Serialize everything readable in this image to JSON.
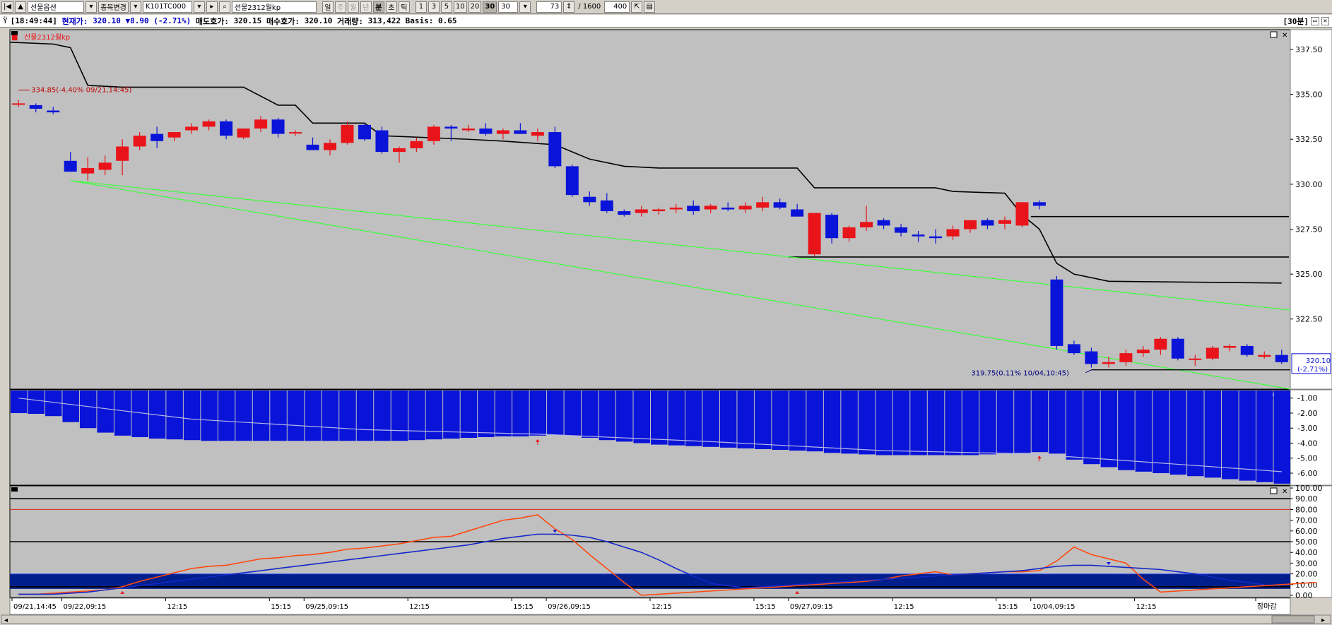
{
  "toolbar": {
    "nav_first": "|◀",
    "nav_up": "▲",
    "market_dropdown": "선물옵션",
    "change_button": "종목변경",
    "code_field": "K101TC000",
    "name_field": "선물2312월kp",
    "periods": [
      "일",
      "주",
      "월",
      "년",
      "분",
      "초",
      "틱"
    ],
    "period_selected": "분",
    "intervals": [
      "1",
      "3",
      "5",
      "10",
      "20",
      "30"
    ],
    "interval_selected": "30",
    "interval_input": "30",
    "count_field": "73",
    "total_label": "/ 1600",
    "display_field": "400"
  },
  "infobar": {
    "time": "[18:49:44]",
    "current_label": "현재가:",
    "current_value": "320.10",
    "change": "▼8.90",
    "change_pct": "(-2.71%)",
    "ask_label": "매도호가:",
    "ask_value": "320.15",
    "bid_label": "매수호가:",
    "bid_value": "320.10",
    "volume_label": "거래량:",
    "volume_value": "313,422",
    "basis_label": "Basis:",
    "basis_value": "0.65",
    "period_badge": "[30분]"
  },
  "colors": {
    "up": "#e8141a",
    "down": "#0a14d8",
    "plot_bg": "#c0c0c0",
    "trend": "#3cff3c",
    "stoch_k": "#ff4a10",
    "stoch_d": "#1428c8",
    "band": "#001e8c"
  },
  "chart_data": [
    {
      "type": "candlestick",
      "title": "선물2312월kp",
      "ylim": [
        318.6,
        338.6
      ],
      "y_ticks": [
        "337.50",
        "335.00",
        "332.50",
        "330.00",
        "327.50",
        "325.00",
        "322.50"
      ],
      "current_price_label": "320.10",
      "current_change_label": "(-2.71%)",
      "high_annotation": "334.85(-4.40% 09/21,14:45)",
      "low_annotation": "319.75(0.11% 10/04,10:45)",
      "candles": [
        [
          334.5,
          334.7,
          334.3,
          334.5
        ],
        [
          334.4,
          334.5,
          334.0,
          334.2
        ],
        [
          334.1,
          334.3,
          333.9,
          334.0
        ],
        [
          331.3,
          331.8,
          330.7,
          330.7
        ],
        [
          330.6,
          331.5,
          330.2,
          330.9
        ],
        [
          330.8,
          331.6,
          330.5,
          331.2
        ],
        [
          331.3,
          332.5,
          330.5,
          332.1
        ],
        [
          332.1,
          332.9,
          331.9,
          332.7
        ],
        [
          332.8,
          333.2,
          332.0,
          332.4
        ],
        [
          332.6,
          332.9,
          332.4,
          332.9
        ],
        [
          333.0,
          333.4,
          332.8,
          333.2
        ],
        [
          333.2,
          333.6,
          333.0,
          333.5
        ],
        [
          333.5,
          333.6,
          332.5,
          332.7
        ],
        [
          332.6,
          333.1,
          332.5,
          333.1
        ],
        [
          333.1,
          333.8,
          332.9,
          333.6
        ],
        [
          333.6,
          333.7,
          332.6,
          332.8
        ],
        [
          332.9,
          333.0,
          332.7,
          332.9
        ],
        [
          332.2,
          332.6,
          331.9,
          331.9
        ],
        [
          331.9,
          332.5,
          331.6,
          332.3
        ],
        [
          332.3,
          333.5,
          332.2,
          333.3
        ],
        [
          333.3,
          333.4,
          332.4,
          332.5
        ],
        [
          333.0,
          333.2,
          331.7,
          331.8
        ],
        [
          331.8,
          332.1,
          331.2,
          332.0
        ],
        [
          332.0,
          332.6,
          331.8,
          332.4
        ],
        [
          332.4,
          333.3,
          332.2,
          333.2
        ],
        [
          333.2,
          333.3,
          332.4,
          333.1
        ],
        [
          333.0,
          333.3,
          332.9,
          333.1
        ],
        [
          333.1,
          333.4,
          332.7,
          332.8
        ],
        [
          332.8,
          333.1,
          332.5,
          333.0
        ],
        [
          333.0,
          333.4,
          332.8,
          332.8
        ],
        [
          332.7,
          333.1,
          332.4,
          332.9
        ],
        [
          332.9,
          333.2,
          330.9,
          331.0
        ],
        [
          331.0,
          331.1,
          329.3,
          329.4
        ],
        [
          329.3,
          329.6,
          328.8,
          329.0
        ],
        [
          329.1,
          329.5,
          328.4,
          328.5
        ],
        [
          328.5,
          328.6,
          328.2,
          328.3
        ],
        [
          328.4,
          328.8,
          328.2,
          328.6
        ],
        [
          328.5,
          328.7,
          328.3,
          328.6
        ],
        [
          328.6,
          328.9,
          328.4,
          328.7
        ],
        [
          328.8,
          329.1,
          328.3,
          328.5
        ],
        [
          328.6,
          328.9,
          328.4,
          328.8
        ],
        [
          328.7,
          329.0,
          328.5,
          328.6
        ],
        [
          328.6,
          329.0,
          328.4,
          328.8
        ],
        [
          328.7,
          329.3,
          328.5,
          329.0
        ],
        [
          329.0,
          329.2,
          328.6,
          328.7
        ],
        [
          328.6,
          328.9,
          328.2,
          328.2
        ],
        [
          326.1,
          328.4,
          326.0,
          328.4
        ],
        [
          328.3,
          328.4,
          326.7,
          327.0
        ],
        [
          327.0,
          327.7,
          326.8,
          327.6
        ],
        [
          327.6,
          328.8,
          327.4,
          327.9
        ],
        [
          328.0,
          328.1,
          327.5,
          327.7
        ],
        [
          327.6,
          327.8,
          327.1,
          327.3
        ],
        [
          327.2,
          327.4,
          326.8,
          327.1
        ],
        [
          327.1,
          327.5,
          326.7,
          327.0
        ],
        [
          327.1,
          327.7,
          326.9,
          327.5
        ],
        [
          327.5,
          328.0,
          327.3,
          328.0
        ],
        [
          328.0,
          328.1,
          327.5,
          327.7
        ],
        [
          327.8,
          328.2,
          327.5,
          328.0
        ],
        [
          327.7,
          329.0,
          327.6,
          329.0
        ],
        [
          329.0,
          329.1,
          328.6,
          328.8
        ],
        [
          324.7,
          324.9,
          320.8,
          321.0
        ],
        [
          321.1,
          321.3,
          320.5,
          320.6
        ],
        [
          320.7,
          320.9,
          319.8,
          320.0
        ],
        [
          320.0,
          320.4,
          319.8,
          320.1
        ],
        [
          320.1,
          320.8,
          319.9,
          320.6
        ],
        [
          320.6,
          321.0,
          320.4,
          320.8
        ],
        [
          320.8,
          321.5,
          320.5,
          321.4
        ],
        [
          321.4,
          321.5,
          320.2,
          320.3
        ],
        [
          320.3,
          320.5,
          319.9,
          320.3
        ],
        [
          320.3,
          321.0,
          320.2,
          320.9
        ],
        [
          320.9,
          321.1,
          320.7,
          321.0
        ],
        [
          321.0,
          321.1,
          320.4,
          320.5
        ],
        [
          320.4,
          320.7,
          320.3,
          320.5
        ],
        [
          320.5,
          320.8,
          320.0,
          320.1
        ]
      ],
      "envelope": [
        [
          0,
          337.9
        ],
        [
          2,
          337.8
        ],
        [
          3,
          337.6
        ],
        [
          4,
          335.5
        ],
        [
          6,
          335.4
        ],
        [
          13,
          335.4
        ],
        [
          15,
          334.4
        ],
        [
          16,
          334.4
        ],
        [
          17,
          333.4
        ],
        [
          20,
          333.4
        ],
        [
          21,
          332.7
        ],
        [
          26,
          332.5
        ],
        [
          28,
          332.4
        ],
        [
          31,
          332.2
        ],
        [
          33,
          331.4
        ],
        [
          35,
          331.0
        ],
        [
          37,
          330.9
        ],
        [
          45,
          330.9
        ],
        [
          46,
          329.8
        ],
        [
          53,
          329.8
        ],
        [
          54,
          329.6
        ],
        [
          57,
          329.5
        ],
        [
          58,
          328.3
        ],
        [
          59,
          327.5
        ],
        [
          60,
          325.6
        ],
        [
          61,
          325.0
        ],
        [
          63,
          324.6
        ],
        [
          73,
          324.5
        ]
      ],
      "resistance_levels": [
        [
          59,
          73,
          328.2
        ],
        [
          45,
          73,
          325.95
        ]
      ],
      "trendlines": [
        [
          3,
          330.2,
          73,
          323.0
        ],
        [
          3,
          330.2,
          73,
          318.6
        ]
      ]
    },
    {
      "type": "bar",
      "ylim": [
        -6.8,
        -0.45
      ],
      "y_ticks": [
        "-1.00",
        "-2.00",
        "-3.00",
        "-4.00",
        "-5.00",
        "-6.00"
      ],
      "values": [
        -2.0,
        -2.05,
        -2.2,
        -2.6,
        -3.0,
        -3.3,
        -3.5,
        -3.6,
        -3.7,
        -3.75,
        -3.8,
        -3.85,
        -3.85,
        -3.85,
        -3.85,
        -3.85,
        -3.85,
        -3.85,
        -3.85,
        -3.85,
        -3.85,
        -3.85,
        -3.85,
        -3.8,
        -3.75,
        -3.7,
        -3.65,
        -3.6,
        -3.55,
        -3.55,
        -3.5,
        -3.45,
        -3.5,
        -3.65,
        -3.8,
        -3.9,
        -4.0,
        -4.1,
        -4.15,
        -4.2,
        -4.25,
        -4.3,
        -4.35,
        -4.4,
        -4.45,
        -4.5,
        -4.55,
        -4.65,
        -4.7,
        -4.75,
        -4.8,
        -4.8,
        -4.8,
        -4.8,
        -4.8,
        -4.8,
        -4.75,
        -4.7,
        -4.65,
        -4.6,
        -4.7,
        -5.1,
        -5.4,
        -5.6,
        -5.8,
        -5.9,
        -6.0,
        -6.1,
        -6.2,
        -6.3,
        -6.4,
        -6.5,
        -6.6,
        -6.7
      ],
      "signal": [
        [
          0,
          -1.0
        ],
        [
          10,
          -2.4
        ],
        [
          20,
          -3.1
        ],
        [
          30,
          -3.4
        ],
        [
          40,
          -3.9
        ],
        [
          50,
          -4.5
        ],
        [
          58,
          -4.7
        ],
        [
          62,
          -5.0
        ],
        [
          73,
          -5.9
        ]
      ],
      "markers": [
        30,
        59
      ]
    },
    {
      "type": "line",
      "ylim": [
        -2,
        102
      ],
      "y_ticks": [
        "100.00",
        "90.00",
        "80.00",
        "70.00",
        "60.00",
        "50.00",
        "40.00",
        "30.00",
        "20.00",
        "10.00",
        "0.00"
      ],
      "ref_lines": [
        90,
        50,
        8
      ],
      "red_line": 80,
      "band": [
        6,
        20
      ],
      "series": [
        {
          "values": [
            1,
            1,
            2,
            3,
            4,
            5,
            8,
            13,
            17,
            21,
            25,
            27,
            28,
            31,
            34,
            35,
            37,
            38,
            40,
            43,
            44,
            46,
            48,
            51,
            54,
            55,
            60,
            65,
            70,
            72,
            75,
            62,
            52,
            38,
            25,
            12,
            0,
            1,
            2,
            3,
            4,
            5,
            6,
            7,
            8,
            9,
            10,
            11,
            12,
            13,
            15,
            18,
            20,
            22,
            19,
            20,
            21,
            22,
            22,
            23,
            32,
            45,
            38,
            34,
            30,
            15,
            3,
            4,
            5,
            6,
            7,
            8,
            9,
            10,
            11,
            12
          ]
        },
        {
          "values": [
            1,
            1,
            1,
            2,
            3,
            5,
            7,
            9,
            11,
            13,
            15,
            17,
            19,
            21,
            23,
            25,
            27,
            29,
            31,
            33,
            35,
            37,
            39,
            41,
            43,
            45,
            47,
            50,
            53,
            55,
            57,
            57,
            56,
            54,
            50,
            45,
            40,
            33,
            25,
            18,
            11,
            9,
            7,
            8,
            9,
            10,
            11,
            12,
            13,
            14,
            15,
            16,
            17,
            18,
            19,
            20,
            21,
            22,
            23,
            25,
            27,
            28,
            28,
            27,
            26,
            25,
            24,
            22,
            20,
            17,
            14,
            12,
            10
          ]
        }
      ],
      "markers_down": [
        31,
        63
      ],
      "markers_up": [
        6,
        45
      ]
    }
  ],
  "x_ticks": [
    {
      "i": 0,
      "label": "09/21,14:45"
    },
    {
      "i": 3,
      "label": "09/22,09:15"
    },
    {
      "i": 9,
      "label": "12:15"
    },
    {
      "i": 15,
      "label": "15:15"
    },
    {
      "i": 17,
      "label": "09/25,09:15"
    },
    {
      "i": 23,
      "label": "12:15"
    },
    {
      "i": 29,
      "label": "15:15"
    },
    {
      "i": 31,
      "label": "09/26,09:15"
    },
    {
      "i": 37,
      "label": "12:15"
    },
    {
      "i": 43,
      "label": "15:15"
    },
    {
      "i": 45,
      "label": "09/27,09:15"
    },
    {
      "i": 51,
      "label": "12:15"
    },
    {
      "i": 57,
      "label": "15:15"
    },
    {
      "i": 59,
      "label": "10/04,09:15"
    },
    {
      "i": 65,
      "label": "12:15"
    },
    {
      "i": 72,
      "label": "장마감"
    }
  ]
}
